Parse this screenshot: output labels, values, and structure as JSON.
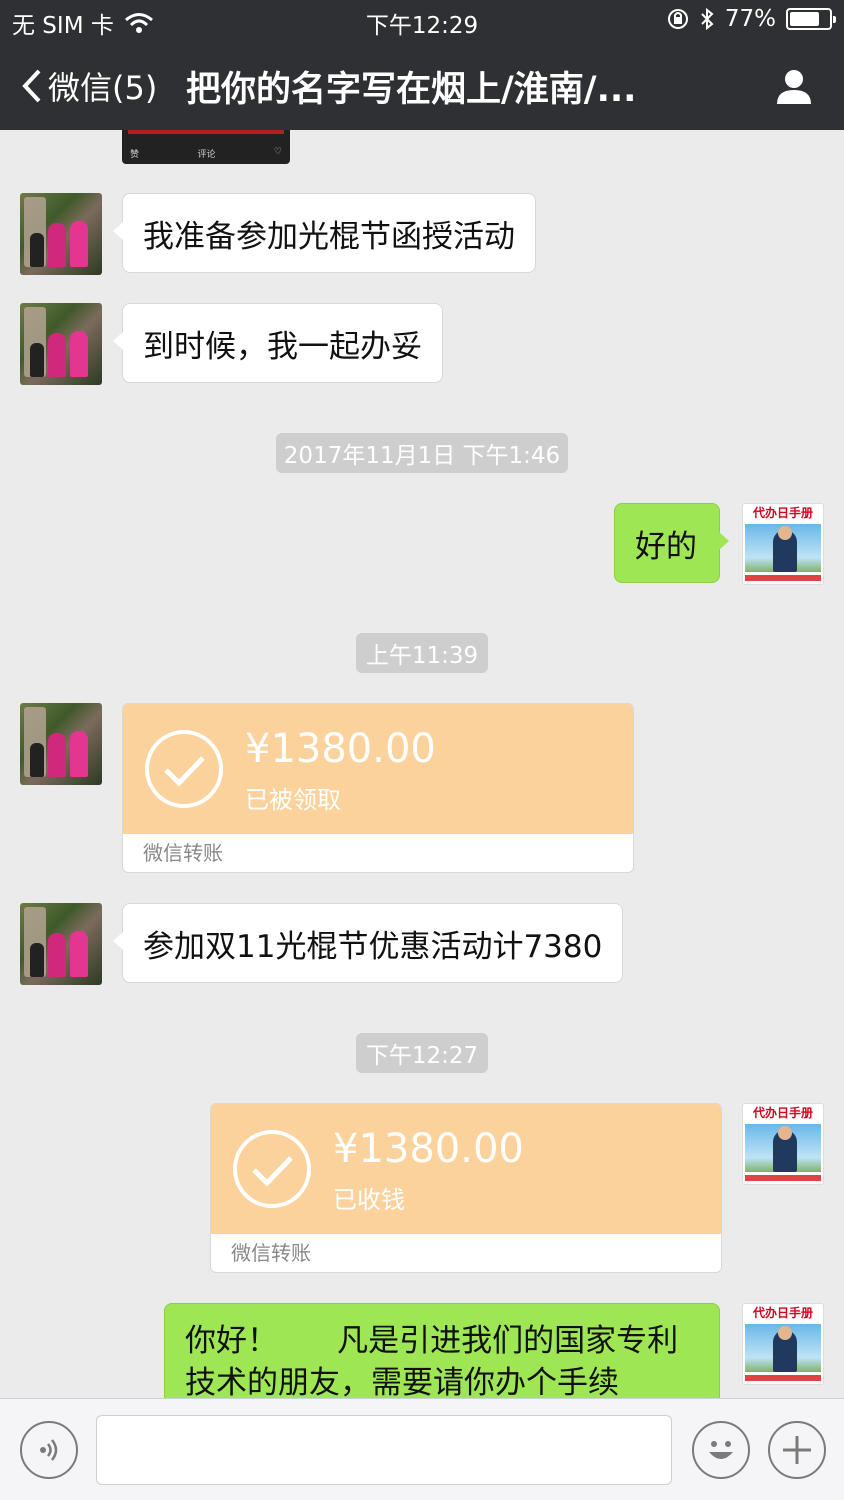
{
  "status_bar": {
    "carrier": "无 SIM 卡",
    "time": "下午12:29",
    "battery": "77%",
    "battery_level": 0.77
  },
  "nav": {
    "back_label": "微信(5)",
    "title": "把你的名字写在烟上/淮南/..."
  },
  "previous_card": {
    "like": "赞",
    "comment": "评论"
  },
  "messages": [
    {
      "side": "left",
      "type": "text",
      "text": "我准备参加光棍节函授活动"
    },
    {
      "side": "left",
      "type": "text",
      "text": "到时候，我一起办妥"
    },
    {
      "type": "time",
      "text": "2017年11月1日 下午1:46"
    },
    {
      "side": "right",
      "type": "text",
      "text": "好的"
    },
    {
      "type": "time",
      "text": "上午11:39"
    },
    {
      "side": "left",
      "type": "transfer",
      "amount": "¥1380.00",
      "status": "已被领取",
      "footer": "微信转账"
    },
    {
      "side": "left",
      "type": "text",
      "text": "参加双11光棍节优惠活动计7380"
    },
    {
      "type": "time",
      "text": "下午12:27"
    },
    {
      "side": "right",
      "type": "transfer",
      "amount": "¥1380.00",
      "status": "已收钱",
      "footer": "微信转账"
    },
    {
      "side": "right",
      "type": "text",
      "line1": "你好！      凡是引进我们的国家专利",
      "line2": "技术的朋友，需要请你办个手续"
    }
  ],
  "colors": {
    "header_bg": "#2f3033",
    "chat_bg": "#ebebeb",
    "green_bubble": "#9ee654",
    "transfer_bg": "#fcd29c"
  }
}
